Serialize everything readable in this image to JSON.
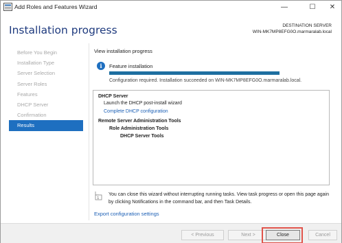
{
  "window": {
    "title": "Add Roles and Features Wizard",
    "controls": {
      "minimize": "—",
      "maximize": "☐",
      "close": "✕"
    }
  },
  "header": {
    "title": "Installation progress",
    "destination_label": "DESTINATION SERVER",
    "destination_server": "WIN-MK7MP8EFG0O.marmaralab.local"
  },
  "nav": {
    "items": [
      {
        "label": "Before You Begin",
        "active": false
      },
      {
        "label": "Installation Type",
        "active": false
      },
      {
        "label": "Server Selection",
        "active": false
      },
      {
        "label": "Server Roles",
        "active": false
      },
      {
        "label": "Features",
        "active": false
      },
      {
        "label": "DHCP Server",
        "active": false
      },
      {
        "label": "Confirmation",
        "active": false
      },
      {
        "label": "Results",
        "active": true
      }
    ]
  },
  "content": {
    "view_progress": "View installation progress",
    "feature_install": "Feature installation",
    "progress": 1.0,
    "config_status": "Configuration required. Installation succeeded on WIN-MK7MP8EFG0O.marmaralab.local.",
    "results": {
      "dhcp_server": "DHCP Server",
      "launch_wizard": "Launch the DHCP post-install wizard",
      "complete_dhcp_link": "Complete DHCP configuration",
      "rsat": "Remote Server Administration Tools",
      "role_admin_tools": "Role Administration Tools",
      "dhcp_server_tools": "DHCP Server Tools"
    },
    "note": "You can close this wizard without interrupting running tasks. View task progress or open this page again by clicking Notifications in the command bar, and then Task Details.",
    "export_link": "Export configuration settings"
  },
  "footer": {
    "previous": "< Previous",
    "next": "Next >",
    "close": "Close",
    "cancel": "Cancel"
  },
  "colors": {
    "accent": "#1e6fc0",
    "header_title": "#1e3a7e",
    "highlight": "#e0534a",
    "link": "#1b5fb5"
  }
}
